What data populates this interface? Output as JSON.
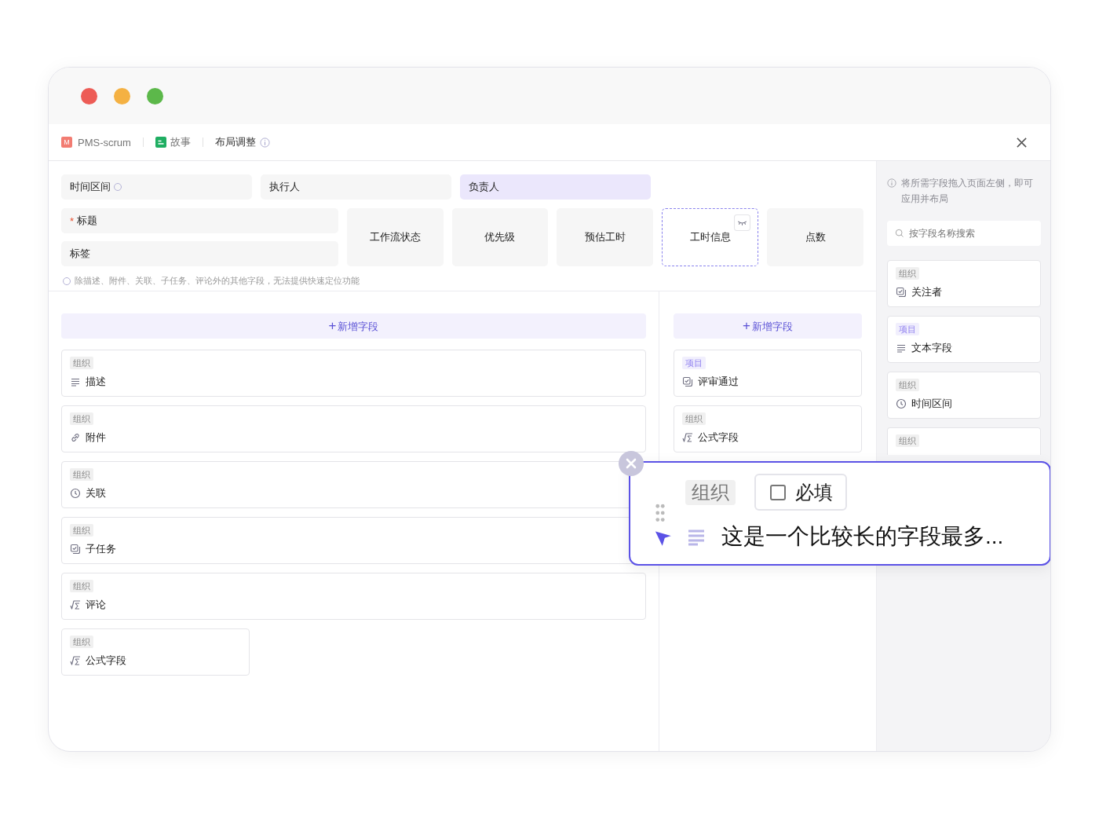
{
  "breadcrumb": {
    "project_badge": "M",
    "project": "PMS-scrum",
    "type": "故事",
    "page": "布局调整"
  },
  "required_mark": "*",
  "top_fields": [
    {
      "label": "时间区间",
      "highlighted": false,
      "hint_icon": true
    },
    {
      "label": "执行人",
      "highlighted": false,
      "hint_icon": false
    },
    {
      "label": "负责人",
      "highlighted": true,
      "hint_icon": false
    }
  ],
  "side_fields": [
    {
      "label": "标题",
      "required": true
    },
    {
      "label": "标签",
      "required": false
    }
  ],
  "tiles": [
    {
      "label": "工作流状态",
      "hidden": false
    },
    {
      "label": "优先级",
      "hidden": false
    },
    {
      "label": "预估工时",
      "hidden": false
    },
    {
      "label": "工时信息",
      "hidden": true
    },
    {
      "label": "点数",
      "hidden": false
    }
  ],
  "layout_hint": "除描述、附件、关联、子任务、评论外的其他字段，无法提供快速定位功能",
  "columns": [
    {
      "add_icon": "+",
      "add_label": "新增字段",
      "cards": [
        {
          "tag": {
            "label": "组织",
            "color": "#f0f0f0"
          },
          "kind": "text",
          "name": "描述",
          "wide": true
        },
        {
          "tag": {
            "label": "组织",
            "color": "#f0f0f0"
          },
          "kind": "link",
          "name": "附件",
          "wide": true
        },
        {
          "tag": {
            "label": "组织",
            "color": "#f0f0f0"
          },
          "kind": "clock",
          "name": "关联",
          "wide": true
        },
        {
          "tag": {
            "label": "组织",
            "color": "#f0f0f0"
          },
          "kind": "check",
          "name": "子任务",
          "wide": true
        },
        {
          "tag": {
            "label": "组织",
            "color": "#f0f0f0"
          },
          "kind": "formula",
          "name": "评论",
          "wide": true
        },
        {
          "tag": {
            "label": "组织",
            "color": "#f0f0f0"
          },
          "kind": "formula",
          "name": "公式字段",
          "wide": false
        }
      ]
    },
    {
      "add_icon": "+",
      "add_label": "新增字段",
      "cards": [
        {
          "tag": {
            "label": "项目",
            "color": "#f1effd"
          },
          "kind": "check",
          "name": "评审通过"
        },
        {
          "tag": {
            "label": "组织",
            "color": "#f0f0f0"
          },
          "kind": "formula",
          "name": "公式字段"
        }
      ]
    }
  ],
  "sidebar": {
    "hint": "将所需字段拖入页面左侧，即可应用并布局",
    "search": {
      "placeholder": "按字段名称搜索"
    },
    "cards": [
      {
        "tag": {
          "label": "组织",
          "color": "#f0f0f0"
        },
        "kind": "check",
        "name": "关注者"
      },
      {
        "tag": {
          "label": "项目",
          "color": "#f1effd"
        },
        "kind": "text",
        "name": "文本字段"
      },
      {
        "tag": {
          "label": "组织",
          "color": "#f0f0f0"
        },
        "kind": "clock",
        "name": "时间区间"
      },
      {
        "tag": {
          "label": "组织",
          "color": "#f0f0f0"
        }
      }
    ]
  },
  "drag_card": {
    "tag": "组织",
    "required_label": "必填",
    "required": false,
    "kind": "text",
    "name": "这是一个比较长的字段最多..."
  }
}
